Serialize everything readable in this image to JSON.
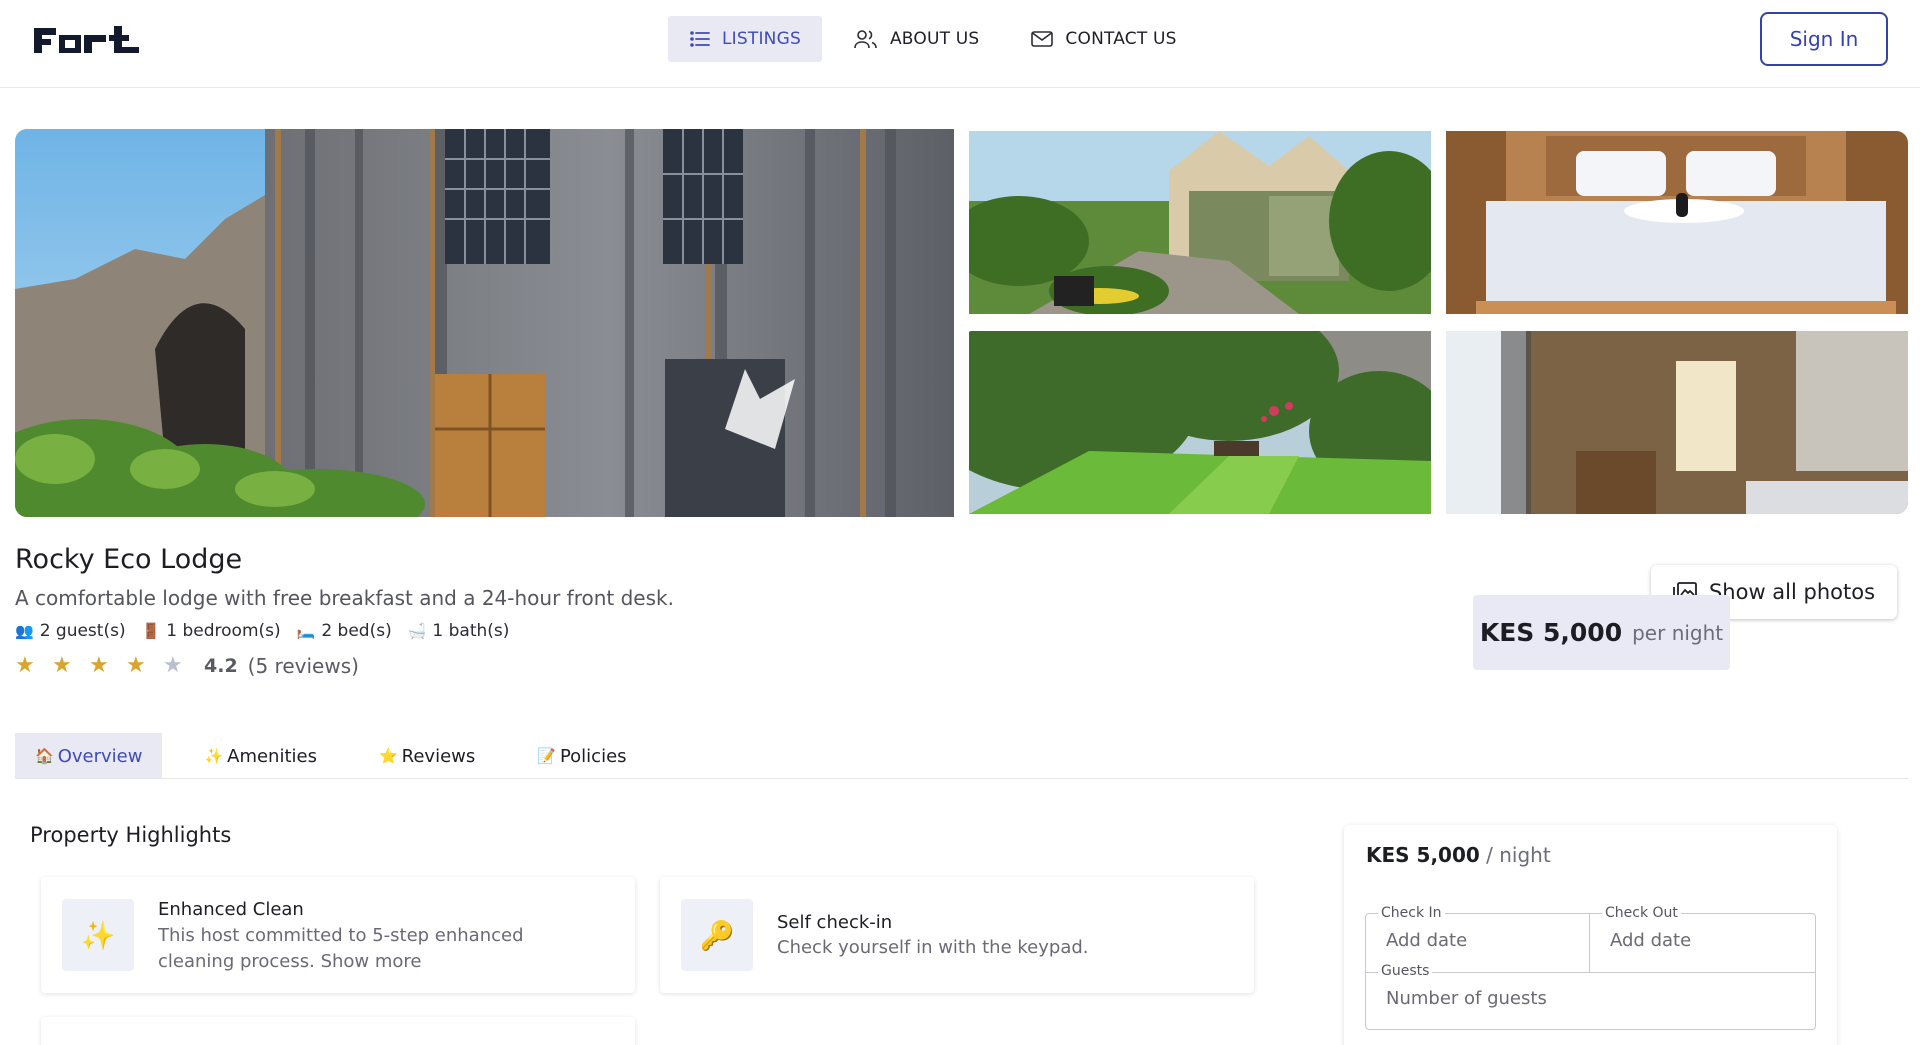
{
  "header": {
    "logo": "Fort",
    "nav": [
      {
        "label": "LISTINGS",
        "icon": "list-icon",
        "active": true
      },
      {
        "label": "ABOUT US",
        "icon": "users-icon",
        "active": false
      },
      {
        "label": "CONTACT US",
        "icon": "mail-icon",
        "active": false
      }
    ],
    "sign_in": "Sign In"
  },
  "gallery": {
    "show_all": "Show all photos"
  },
  "listing": {
    "title": "Rocky Eco Lodge",
    "description": "A comfortable lodge with free breakfast and a 24-hour front desk.",
    "facts": [
      {
        "emoji": "👥",
        "text": "2 guest(s)"
      },
      {
        "emoji": "🚪",
        "text": "1 bedroom(s)"
      },
      {
        "emoji": "🛏️",
        "text": "2 bed(s)"
      },
      {
        "emoji": "🛁",
        "text": "1 bath(s)"
      }
    ],
    "rating": "4.2",
    "rating_stars": 4,
    "reviews": "(5 reviews)",
    "price": "KES 5,000",
    "per_night": "per night"
  },
  "tabs": [
    {
      "emoji": "🏠",
      "label": "Overview",
      "active": true
    },
    {
      "emoji": "✨",
      "label": "Amenities",
      "active": false
    },
    {
      "emoji": "⭐",
      "label": "Reviews",
      "active": false
    },
    {
      "emoji": "📝",
      "label": "Policies",
      "active": false
    }
  ],
  "highlights": {
    "title": "Property Highlights",
    "items": [
      {
        "emoji": "✨",
        "title": "Enhanced Clean",
        "text": "This host committed to 5-step enhanced cleaning process. Show more"
      },
      {
        "emoji": "🔑",
        "title": "Self check-in",
        "text": "Check yourself in with the keypad."
      }
    ]
  },
  "booking": {
    "price": "KES 5,000",
    "per": " / night",
    "check_in_label": "Check In",
    "check_in_value": "Add date",
    "check_out_label": "Check Out",
    "check_out_value": "Add date",
    "guests_label": "Guests",
    "guests_value": "Number of guests"
  },
  "colors": {
    "accent": "#3441b0",
    "accent_bg": "#e8e9f3",
    "star": "#d9a52e"
  }
}
